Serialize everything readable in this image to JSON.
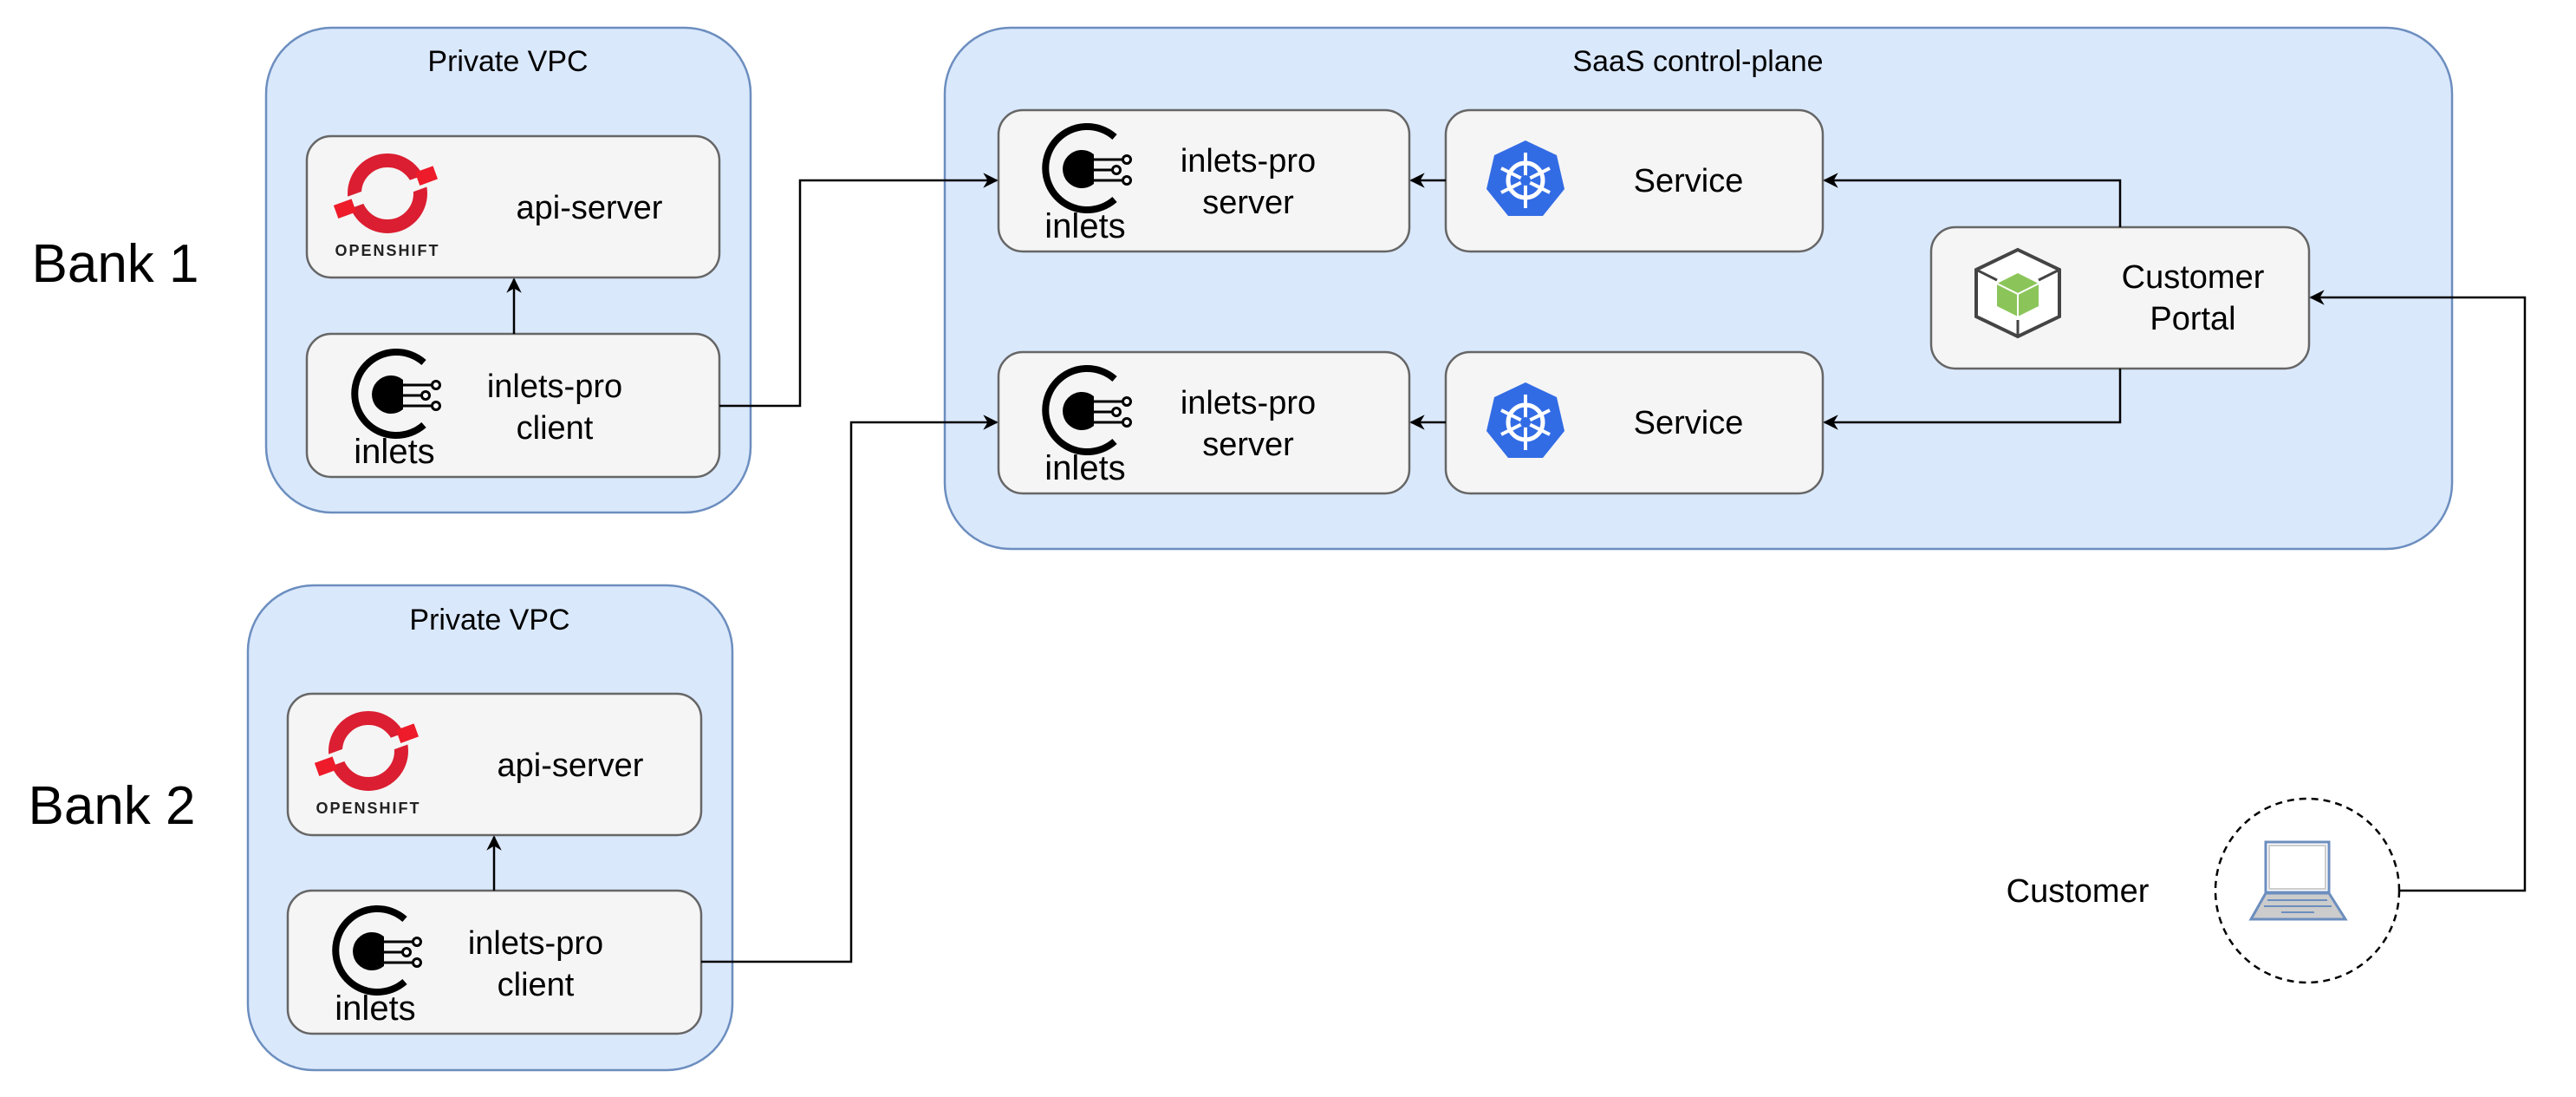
{
  "banks": [
    {
      "label": "Bank 1",
      "vpc_title": "Private VPC",
      "api_label": "api-server",
      "client_label": [
        "inlets-pro",
        "client"
      ]
    },
    {
      "label": "Bank 2",
      "vpc_title": "Private VPC",
      "api_label": "api-server",
      "client_label": [
        "inlets-pro",
        "client"
      ]
    }
  ],
  "saas": {
    "title": "SaaS control-plane",
    "servers": [
      {
        "label": [
          "inlets-pro",
          "server"
        ]
      },
      {
        "label": [
          "inlets-pro",
          "server"
        ]
      }
    ],
    "services": [
      {
        "label": "Service"
      },
      {
        "label": "Service"
      }
    ],
    "portal": {
      "label": [
        "Customer",
        "Portal"
      ]
    }
  },
  "customer": {
    "label": "Customer"
  },
  "logos": {
    "openshift": "OPENSHIFT",
    "inlets": "inlets"
  },
  "icons": [
    "openshift-logo",
    "inlets-logo",
    "kubernetes-icon",
    "cube-icon",
    "laptop-icon"
  ],
  "colors": {
    "group_fill": "#dae8fc",
    "group_stroke": "#6c8ebf",
    "box_fill": "#f5f5f5",
    "openshift_red": "#db1e31",
    "k8s_blue": "#326ce5",
    "cube_green": "#8bc55a"
  }
}
